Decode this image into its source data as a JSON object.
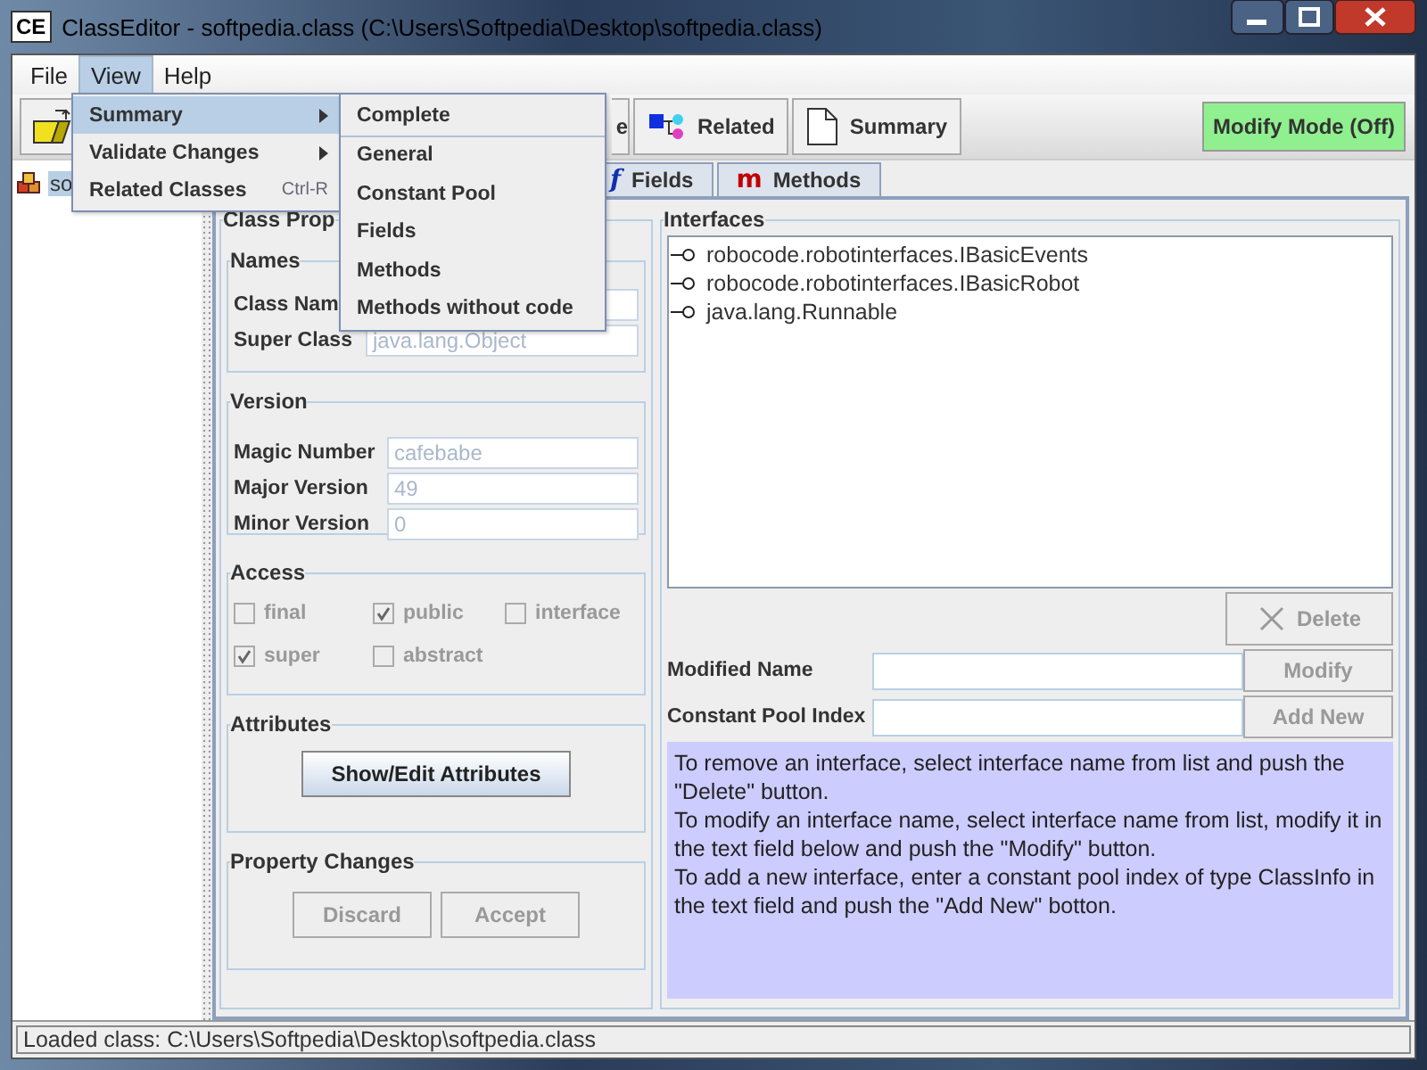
{
  "window": {
    "app_icon": "CE",
    "title": "ClassEditor - softpedia.class (C:\\Users\\Softpedia\\Desktop\\softpedia.class)"
  },
  "menu_bar": [
    {
      "label": "File",
      "selected": false
    },
    {
      "label": "View",
      "selected": true
    },
    {
      "label": "Help",
      "selected": false
    }
  ],
  "view_menu": [
    {
      "label": "Summary",
      "submenu": true,
      "selected": true
    },
    {
      "label": "Validate Changes",
      "submenu": true,
      "selected": false
    },
    {
      "label": "Related Classes",
      "shortcut": "Ctrl-R",
      "submenu": false,
      "selected": false
    }
  ],
  "summary_submenu": [
    {
      "label": "Complete",
      "separator_after": true
    },
    {
      "label": "General",
      "separator_after": false
    },
    {
      "label": "Constant Pool",
      "separator_after": false
    },
    {
      "label": "Fields",
      "separator_after": false
    },
    {
      "label": "Methods",
      "separator_after": false
    },
    {
      "label": "Methods without code",
      "separator_after": false
    }
  ],
  "toolbar": {
    "buttons": [
      {
        "kind": "open"
      },
      {
        "kind": "text",
        "label": "e"
      },
      {
        "kind": "related",
        "label": "Related"
      },
      {
        "kind": "page",
        "label": "Summary"
      }
    ],
    "modify_mode": "Modify Mode (Off)"
  },
  "tree": [
    {
      "label": "so",
      "selected": true
    }
  ],
  "tabs": [
    {
      "icon": "f",
      "label": "Fields",
      "selected": false
    },
    {
      "icon": "m",
      "label": "Methods",
      "selected": false
    }
  ],
  "class_properties": {
    "title": "Class Prop",
    "names": {
      "title": "Names",
      "fields": [
        {
          "label": "Class Nam"
        },
        {
          "label": "Super Class",
          "value": "java.lang.Object"
        }
      ]
    },
    "version": {
      "title": "Version",
      "fields": [
        {
          "label": "Magic Number",
          "value": "cafebabe"
        },
        {
          "label": "Major Version",
          "value": "49"
        },
        {
          "label": "Minor Version",
          "value": "0"
        }
      ]
    },
    "access": {
      "title": "Access",
      "flags": [
        {
          "label": "final",
          "checked": false
        },
        {
          "label": "public",
          "checked": true
        },
        {
          "label": "interface",
          "checked": false
        },
        {
          "label": "super",
          "checked": true
        },
        {
          "label": "abstract",
          "checked": false
        }
      ]
    },
    "attributes": {
      "title": "Attributes",
      "button": {
        "label": "Show/Edit Attributes",
        "disabled": false
      }
    },
    "property_changes": {
      "title": "Property Changes",
      "buttons": [
        {
          "label": "Discard",
          "disabled": true
        },
        {
          "label": "Accept",
          "disabled": true
        }
      ]
    }
  },
  "interfaces": {
    "title": "Interfaces",
    "items": [
      "robocode.robotinterfaces.IBasicEvents",
      "robocode.robotinterfaces.IBasicRobot",
      "java.lang.Runnable"
    ],
    "delete_button": {
      "label": "Delete",
      "disabled": true
    },
    "rows": [
      {
        "label": "Modified Name",
        "button": {
          "label": "Modify",
          "disabled": true
        }
      },
      {
        "label": "Constant Pool Index",
        "button": {
          "label": "Add New",
          "disabled": true
        }
      }
    ],
    "help": [
      "To remove an interface, select interface name from list and push the \"Delete\" button.",
      "To modify an interface name, select interface name from list, modify it in the text field below and push the \"Modify\" button.",
      "To add a new interface, enter a constant pool index of type ClassInfo in the text field and push the \"Add New\" botton."
    ]
  },
  "status_bar": "Loaded class: C:\\Users\\Softpedia\\Desktop\\softpedia.class"
}
